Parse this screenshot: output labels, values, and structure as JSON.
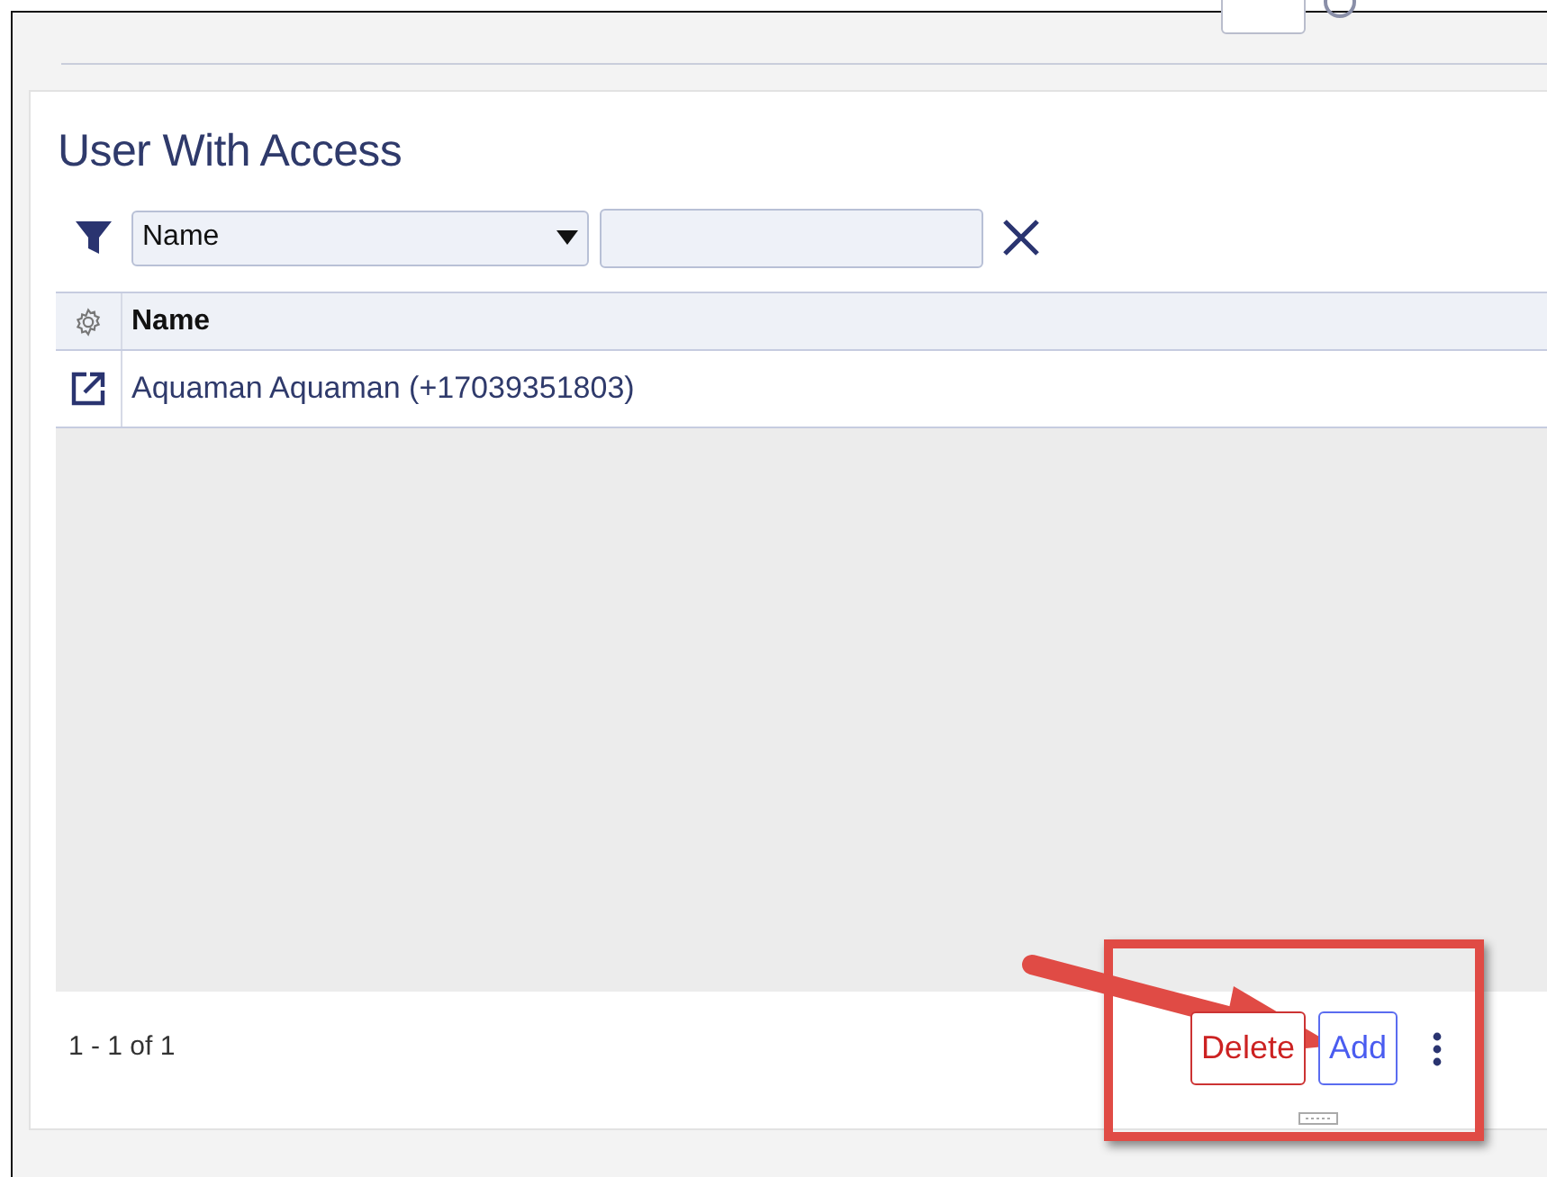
{
  "title": "User With Access",
  "filter": {
    "value": "Name"
  },
  "table": {
    "columns": [
      "Name"
    ],
    "rows": [
      {
        "name": "Aquaman Aquaman (+17039351803)"
      }
    ]
  },
  "footer": {
    "range": "1 - 1 of 1",
    "buttons": [
      {
        "label": "Delete",
        "kind": "danger"
      },
      {
        "label": "Add",
        "kind": "primary"
      }
    ]
  },
  "annotation": {
    "kind": "highlight"
  }
}
